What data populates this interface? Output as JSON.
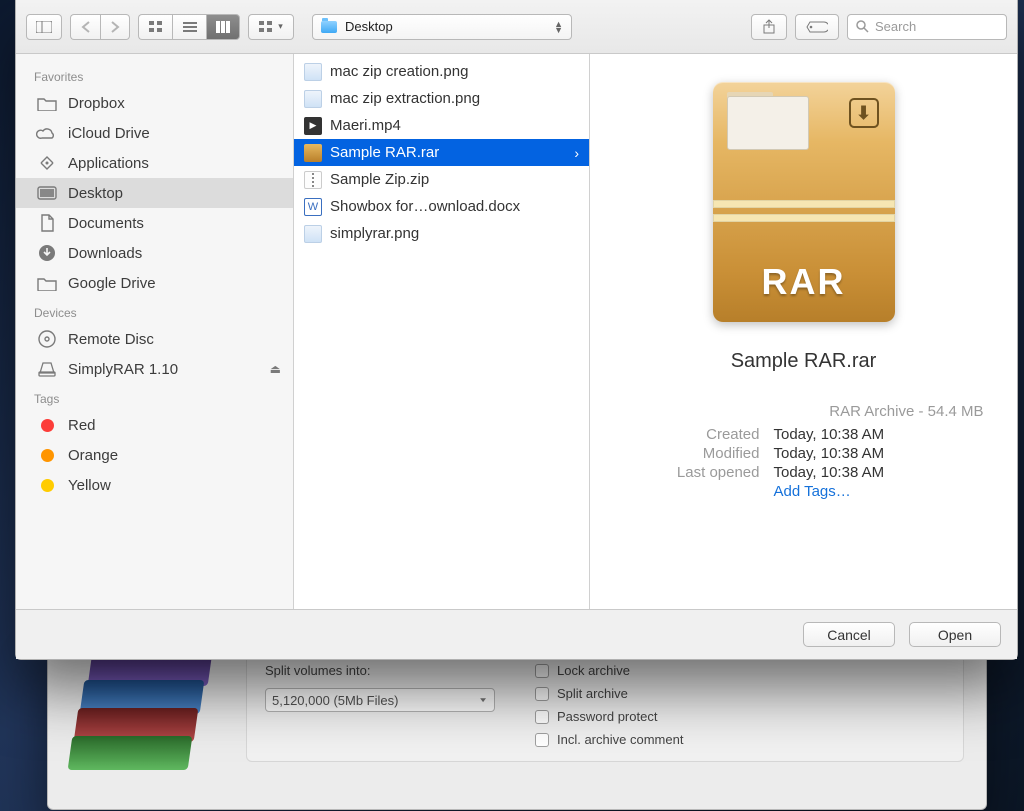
{
  "toolbar": {
    "path_folder": "Desktop",
    "search_placeholder": "Search"
  },
  "sidebar": {
    "sections": [
      {
        "title": "Favorites",
        "items": [
          {
            "icon": "folder",
            "label": "Dropbox",
            "selected": false
          },
          {
            "icon": "cloud",
            "label": "iCloud Drive",
            "selected": false
          },
          {
            "icon": "apps",
            "label": "Applications",
            "selected": false
          },
          {
            "icon": "desktop",
            "label": "Desktop",
            "selected": true
          },
          {
            "icon": "doc",
            "label": "Documents",
            "selected": false
          },
          {
            "icon": "download",
            "label": "Downloads",
            "selected": false
          },
          {
            "icon": "folder",
            "label": "Google Drive",
            "selected": false
          }
        ]
      },
      {
        "title": "Devices",
        "items": [
          {
            "icon": "disc",
            "label": "Remote Disc",
            "selected": false
          },
          {
            "icon": "drive",
            "label": "SimplyRAR 1.10",
            "selected": false,
            "eject": true
          }
        ]
      },
      {
        "title": "Tags",
        "items": [
          {
            "icon": "dot-red",
            "label": "Red"
          },
          {
            "icon": "dot-orange",
            "label": "Orange"
          },
          {
            "icon": "dot-yellow",
            "label": "Yellow"
          }
        ]
      }
    ]
  },
  "files": [
    {
      "kind": "img",
      "name": "mac zip creation.png"
    },
    {
      "kind": "img",
      "name": "mac zip extraction.png"
    },
    {
      "kind": "vid",
      "name": "Maeri.mp4"
    },
    {
      "kind": "rar",
      "name": "Sample RAR.rar",
      "selected": true
    },
    {
      "kind": "zip",
      "name": "Sample Zip.zip"
    },
    {
      "kind": "doc",
      "name": "Showbox for…ownload.docx"
    },
    {
      "kind": "img",
      "name": "simplyrar.png"
    }
  ],
  "preview": {
    "rar_badge": "RAR",
    "filename": "Sample RAR.rar",
    "kind": "RAR Archive - 54.4 MB",
    "rows": [
      {
        "k": "Created",
        "v": "Today, 10:38 AM"
      },
      {
        "k": "Modified",
        "v": "Today, 10:38 AM"
      },
      {
        "k": "Last opened",
        "v": "Today, 10:38 AM"
      }
    ],
    "add_tags": "Add Tags…"
  },
  "footer": {
    "cancel": "Cancel",
    "open": "Open"
  },
  "background_app": {
    "split_label": "Split volumes into:",
    "split_value": "5,120,000 (5Mb Files)",
    "opts": [
      {
        "label": "Lock archive"
      },
      {
        "label": "Split archive"
      },
      {
        "label": "Password protect"
      },
      {
        "label": "Incl. archive comment"
      }
    ]
  }
}
